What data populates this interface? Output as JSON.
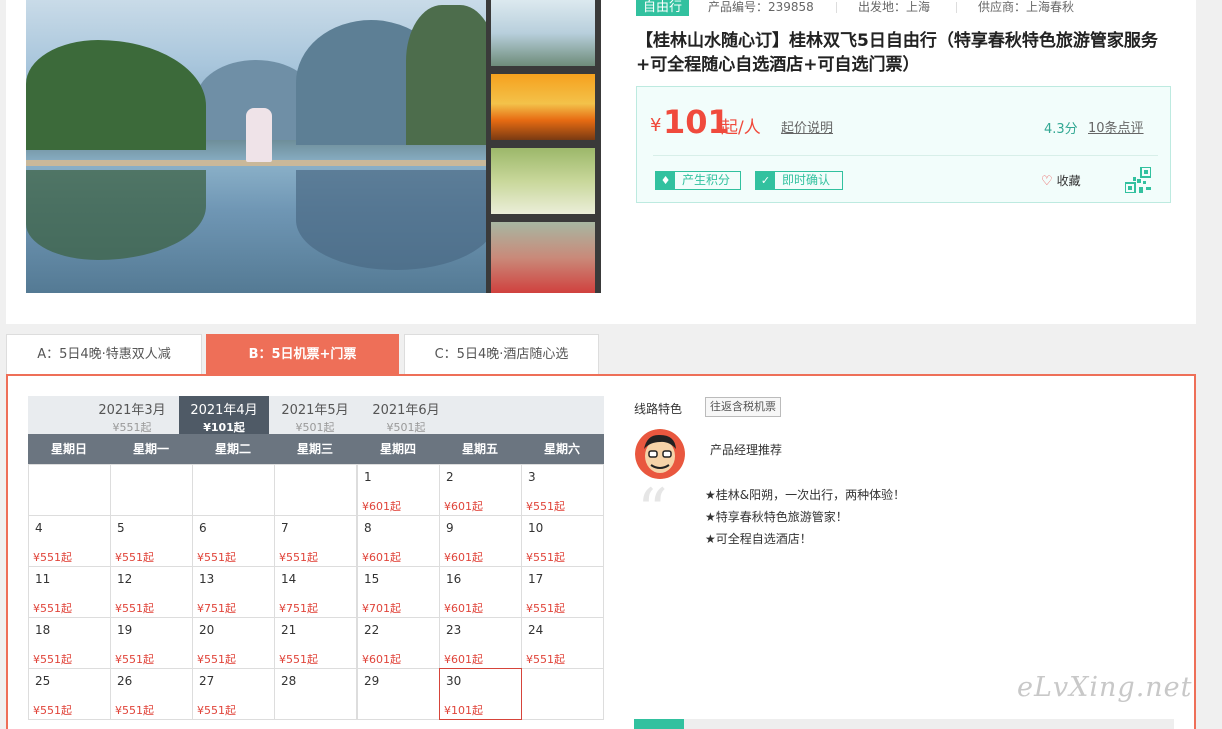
{
  "product": {
    "badge": "自由行",
    "product_no": "产品编号：239858",
    "departure": "出发地：上海",
    "supplier": "供应商：上海春秋",
    "title": "【桂林山水随心订】桂林双飞5日自由行（特享春秋特色旅游管家服务+可全程随心自选酒店+可自选门票）"
  },
  "price": {
    "symbol": "¥",
    "amount": "101",
    "unit": "起/人",
    "note": "起价说明",
    "rating": "4.3分",
    "reviews": "10条点评",
    "tags": [
      {
        "icon": "♦",
        "label": "产生积分"
      },
      {
        "icon": "✓",
        "label": "即时确认"
      }
    ],
    "favorite": "收藏",
    "accent_color": "#32c19f",
    "price_color": "#f04a3c"
  },
  "tabs": [
    {
      "label": "A：5日4晚·特惠双人减"
    },
    {
      "label": "B：5日机票+门票"
    },
    {
      "label": "C：5日4晚·酒店随心选"
    }
  ],
  "calendar": {
    "months": [
      {
        "month": "2021年3月",
        "price": "¥551起"
      },
      {
        "month": "2021年4月",
        "price": "¥101起"
      },
      {
        "month": "2021年5月",
        "price": "¥501起"
      },
      {
        "month": "2021年6月",
        "price": "¥501起"
      }
    ],
    "weekdays": [
      "星期日",
      "星期一",
      "星期二",
      "星期三",
      "星期四",
      "星期五",
      "星期六"
    ],
    "days": [
      {
        "d": "1",
        "p": "¥601起"
      },
      {
        "d": "2",
        "p": "¥601起"
      },
      {
        "d": "3",
        "p": "¥551起"
      },
      {
        "d": "4",
        "p": "¥551起"
      },
      {
        "d": "5",
        "p": "¥551起"
      },
      {
        "d": "6",
        "p": "¥551起"
      },
      {
        "d": "7",
        "p": "¥551起"
      },
      {
        "d": "8",
        "p": "¥601起"
      },
      {
        "d": "9",
        "p": "¥601起"
      },
      {
        "d": "10",
        "p": "¥551起"
      },
      {
        "d": "11",
        "p": "¥551起"
      },
      {
        "d": "12",
        "p": "¥551起"
      },
      {
        "d": "13",
        "p": "¥751起"
      },
      {
        "d": "14",
        "p": "¥751起"
      },
      {
        "d": "15",
        "p": "¥701起"
      },
      {
        "d": "16",
        "p": "¥601起"
      },
      {
        "d": "17",
        "p": "¥551起"
      },
      {
        "d": "18",
        "p": "¥551起"
      },
      {
        "d": "19",
        "p": "¥551起"
      },
      {
        "d": "20",
        "p": "¥551起"
      },
      {
        "d": "21",
        "p": "¥551起"
      },
      {
        "d": "22",
        "p": "¥601起"
      },
      {
        "d": "23",
        "p": "¥601起"
      },
      {
        "d": "24",
        "p": "¥551起"
      },
      {
        "d": "25",
        "p": "¥551起"
      },
      {
        "d": "26",
        "p": "¥551起"
      },
      {
        "d": "27",
        "p": "¥551起"
      },
      {
        "d": "28",
        "p": ""
      },
      {
        "d": "29",
        "p": ""
      },
      {
        "d": "30",
        "p": "¥101起"
      }
    ]
  },
  "features": {
    "label": "线路特色",
    "tag": "往返含税机票",
    "manager": "产品经理推荐",
    "lines": [
      "★桂林&阳朔，一次出行，两种体验！",
      "★特享春秋特色旅游管家！",
      "★可全程自选酒店！"
    ]
  },
  "watermark": "eLvXing.net"
}
